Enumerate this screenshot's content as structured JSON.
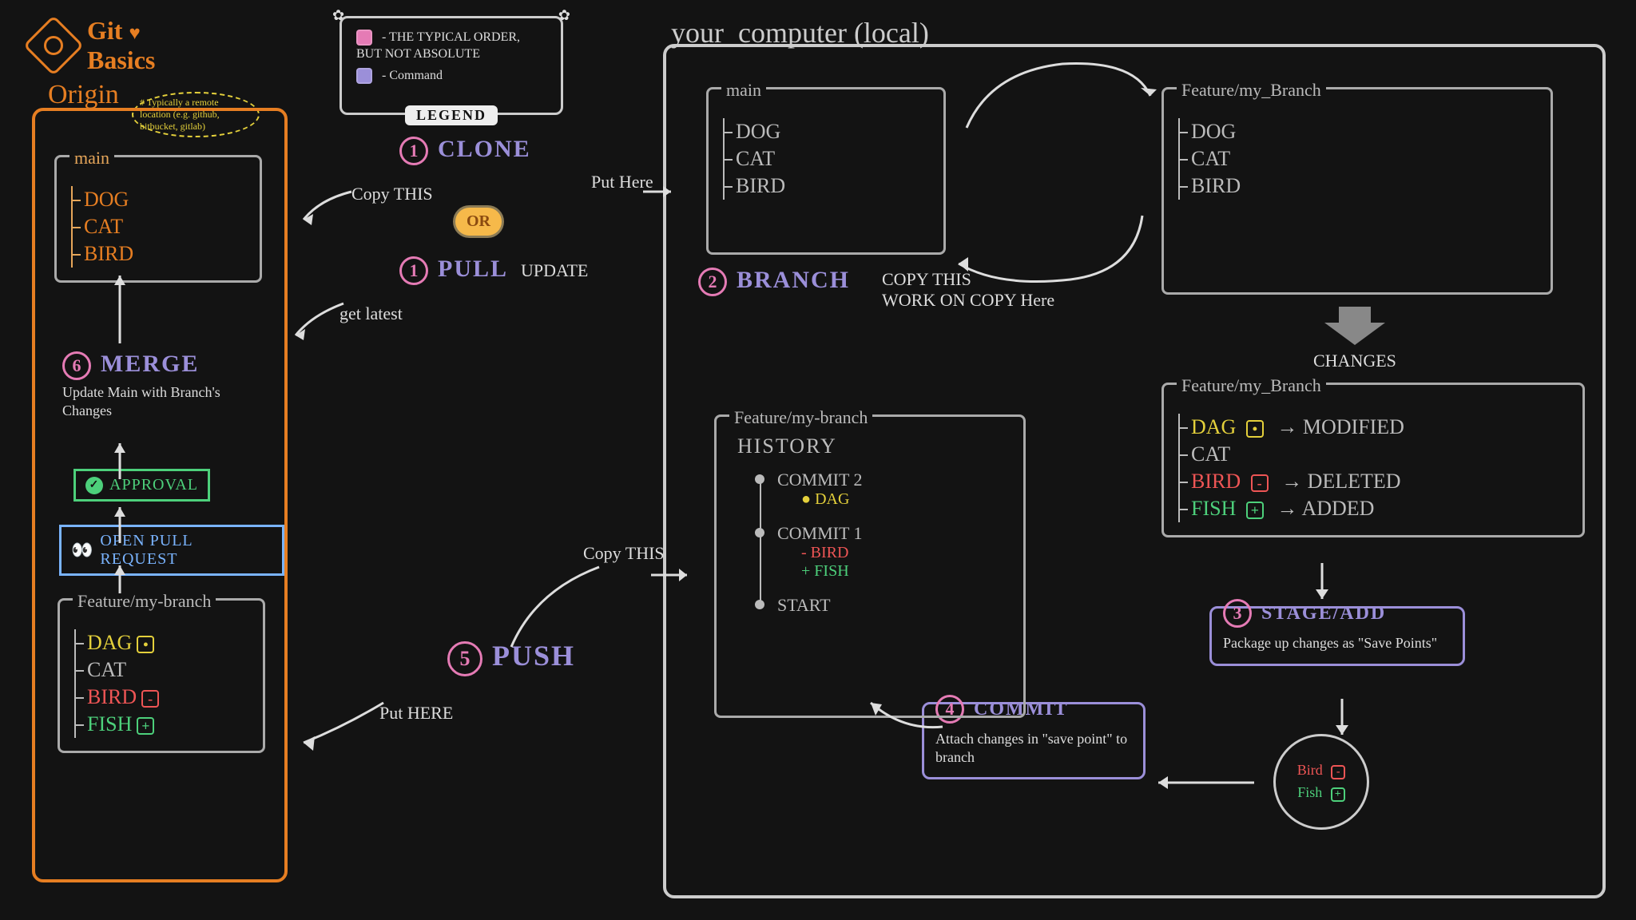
{
  "title": {
    "line1": "Git",
    "line2": "Basics"
  },
  "legend": {
    "title": "LEGEND",
    "rows": [
      {
        "swatch": "pink",
        "text": "- THE TYPICAL ORDER, BUT NOT ABSOLUTE"
      },
      {
        "swatch": "purple",
        "text": "- Command"
      }
    ]
  },
  "origin": {
    "label": "Origin",
    "note": "# Typically a remote location (e.g. github, bitbucket, gitlab)",
    "main": {
      "title": "main",
      "files": [
        "DOG",
        "CAT",
        "BIRD"
      ]
    },
    "merge": {
      "num": "6",
      "cmd": "MERGE",
      "desc": "Update Main with Branch's Changes"
    },
    "approval": "APPROVAL",
    "openPR": "OPEN PULL REQUEST",
    "feature": {
      "title": "Feature/my-branch",
      "files": [
        {
          "name": "DAG",
          "status": "mod"
        },
        {
          "name": "CAT",
          "status": ""
        },
        {
          "name": "BIRD",
          "status": "del"
        },
        {
          "name": "FISH",
          "status": "add"
        }
      ]
    }
  },
  "steps": {
    "clone": {
      "num": "1",
      "cmd": "CLONE",
      "left": "Copy THIS",
      "right": "Put Here"
    },
    "pull": {
      "num": "1",
      "cmd": "PULL",
      "right": "UPDATE",
      "left": "get latest"
    },
    "or": "OR",
    "branch": {
      "num": "2",
      "cmd": "BRANCH",
      "line1": "COPY THIS",
      "line2": "WORK ON COPY Here"
    },
    "stage": {
      "num": "3",
      "cmd": "STAGE/ADD",
      "desc": "Package up changes as \"Save Points\""
    },
    "commit": {
      "num": "4",
      "cmd": "COMMIT",
      "desc": "Attach changes in \"save point\" to branch"
    },
    "push": {
      "num": "5",
      "cmd": "PUSH",
      "right": "Copy THIS",
      "left": "Put HERE"
    }
  },
  "local": {
    "title": "your_computer (local)",
    "main": {
      "title": "main",
      "files": [
        "DOG",
        "CAT",
        "BIRD"
      ]
    },
    "feature": {
      "title": "Feature/my_Branch",
      "files": [
        "DOG",
        "CAT",
        "BIRD"
      ]
    },
    "changesLabel": "CHANGES",
    "featureChanged": {
      "title": "Feature/my_Branch",
      "files": [
        {
          "name": "DAG",
          "status": "mod",
          "note": "MODIFIED"
        },
        {
          "name": "CAT",
          "status": "",
          "note": ""
        },
        {
          "name": "BIRD",
          "status": "del",
          "note": "DELETED"
        },
        {
          "name": "FISH",
          "status": "add",
          "note": "ADDED"
        }
      ]
    },
    "history": {
      "title": "Feature/my-branch",
      "subtitle": "HISTORY",
      "commits": [
        {
          "label": "COMMIT 2",
          "changes": [
            {
              "sym": "●",
              "text": "DAG",
              "cls": "c-yellow"
            }
          ]
        },
        {
          "label": "COMMIT 1",
          "changes": [
            {
              "sym": "-",
              "text": "BIRD",
              "cls": "c-red"
            },
            {
              "sym": "+",
              "text": "FISH",
              "cls": "c-green"
            }
          ]
        },
        {
          "label": "START",
          "changes": []
        }
      ]
    },
    "stageCircle": [
      {
        "name": "Bird",
        "status": "del"
      },
      {
        "name": "Fish",
        "status": "add"
      }
    ]
  }
}
